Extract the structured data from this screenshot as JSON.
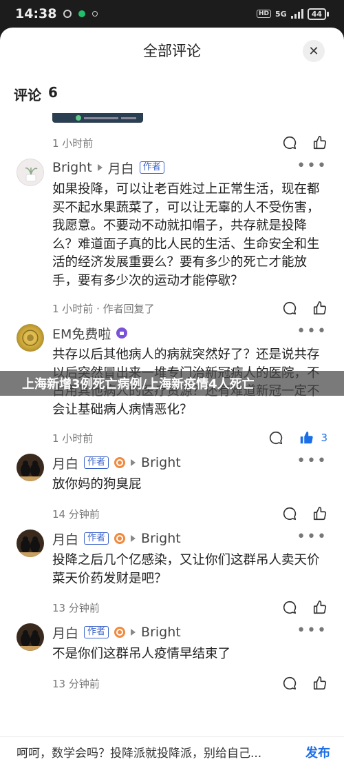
{
  "status_bar": {
    "time": "14:38",
    "network": "5G",
    "hd": "HD",
    "battery": "44"
  },
  "sheet": {
    "title": "全部评论",
    "close_glyph": "✕",
    "count_label": "评论",
    "count_value": "6"
  },
  "first_meta": {
    "time": "1 小时前"
  },
  "comments": [
    {
      "name": "Bright",
      "reply_to": "月白",
      "reply_to_tag": "作者",
      "body": "如果投降，可以让老百姓过上正常生活，现在都买不起水果蔬菜了，可以让无辜的人不受伤害，我愿意。不要动不动就扣帽子，共存就是投降么？难道面子真的比人民的生活、生命安全和生活的经济发展重要么？要有多少的死亡才能放手，要有多少次的运动才能停歇？",
      "meta": "1 小时前 · 作者回复了"
    },
    {
      "name": "EM免费啦",
      "body": "共存以后其他病人的病就突然好了？还是说共存以后突然冒出来一堆专门治新冠病人的医院，不占用其他病人的医疗资源？还有难道新冠一定不会让基础病人病情恶化？",
      "meta": "1 小时前",
      "likes": "3"
    },
    {
      "name": "月白",
      "author_tag": "作者",
      "reply_to": "Bright",
      "body": "放你妈的狗臭屁",
      "meta": "14 分钟前"
    },
    {
      "name": "月白",
      "author_tag": "作者",
      "reply_to": "Bright",
      "body": "投降之后几个亿感染，又让你们这群吊人卖天价菜天价药发财是吧？",
      "meta": "13 分钟前"
    },
    {
      "name": "月白",
      "author_tag": "作者",
      "reply_to": "Bright",
      "body": "不是你们这群吊人疫情早结束了",
      "meta": "13 分钟前"
    }
  ],
  "watermark": "上海新增3例死亡病例/上海新疫情4人死亡",
  "reply_bar": {
    "input_text": "呵呵，数学会吗？投降派就投降派，别给自己...",
    "publish_label": "发布"
  },
  "colors": {
    "accent": "#1a6ee8",
    "author_tag": "#3a62c9"
  }
}
